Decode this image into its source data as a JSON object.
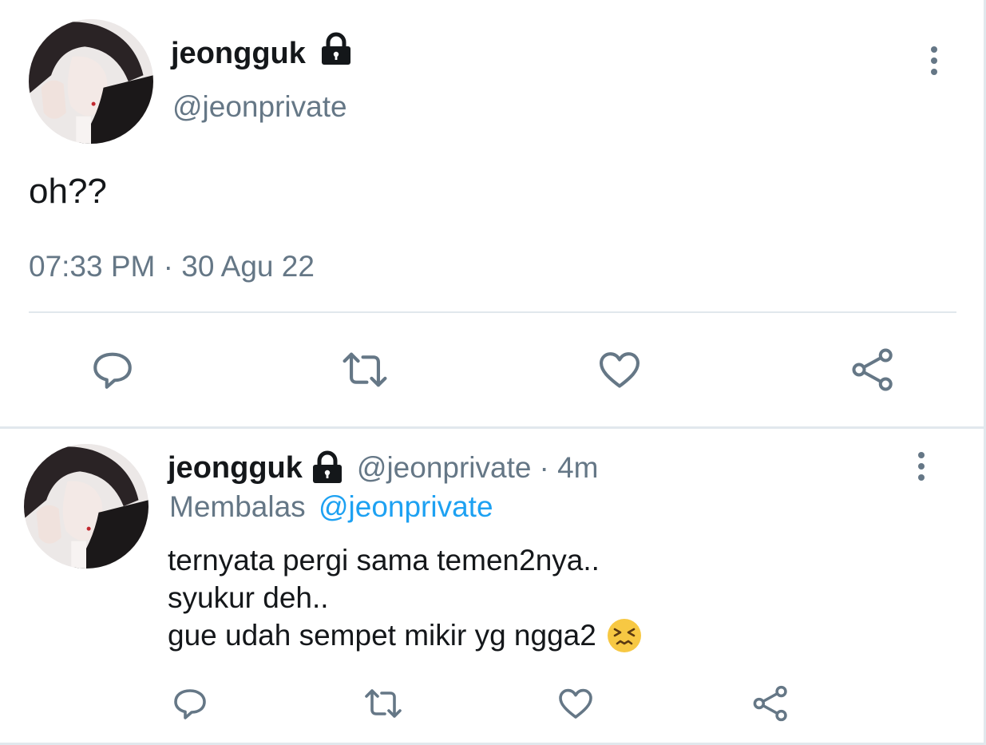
{
  "main_tweet": {
    "display_name": "jeongguk",
    "handle": "@jeonprivate",
    "text": "oh??",
    "timestamp": "07:33 PM · 30 Agu 22",
    "icons": {
      "lock": "lock-icon",
      "more": "more-vertical-icon",
      "reply": "reply-icon",
      "retweet": "retweet-icon",
      "like": "heart-icon",
      "share": "share-icon"
    }
  },
  "reply_tweet": {
    "display_name": "jeongguk",
    "handle": "@jeonprivate",
    "time_ago": "· 4m",
    "replying_prefix": "Membalas",
    "replying_to": "@jeonprivate",
    "lines": [
      "ternyata pergi sama temen2nya..",
      "syukur deh..",
      "gue udah sempet mikir yg ngga2"
    ],
    "emoji": "persevering-face-emoji"
  },
  "colors": {
    "text": "#14171a",
    "muted": "#657786",
    "link": "#1da1f2",
    "divider": "#e1e8ed",
    "icon": "#657786"
  }
}
